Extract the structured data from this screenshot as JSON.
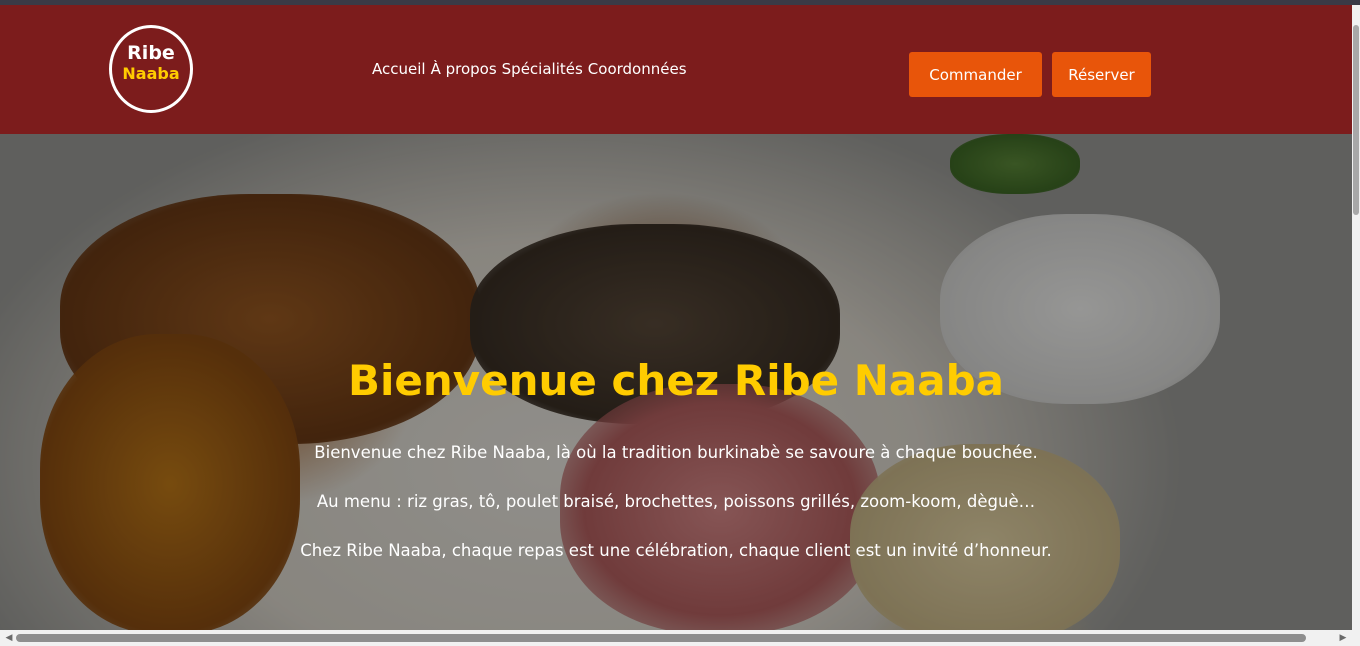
{
  "logo": {
    "line1": "Ribe",
    "line2": "Naaba"
  },
  "nav": {
    "items": [
      "Accueil",
      "À propos",
      "Spécialités",
      "Coordonnées"
    ]
  },
  "actions": {
    "order": "Commander",
    "book": "Réserver"
  },
  "hero": {
    "title": "Bienvenue chez Ribe Naaba",
    "paragraphs": [
      "Bienvenue chez Ribe Naaba, là où la tradition burkinabè se savoure à chaque bouchée.",
      "Au menu : riz gras, tô, poulet braisé, brochettes, poissons grillés, zoom-koom, dèguè…",
      "Chez Ribe Naaba, chaque repas est une célébration, chaque client est un invité d’honneur."
    ]
  },
  "colors": {
    "header_bg": "#7c1c1c",
    "accent_yellow": "#ffcc00",
    "button_orange": "#e8550a"
  },
  "icons": {
    "scroll_left": "chevron-left-icon",
    "scroll_right": "chevron-right-icon"
  }
}
